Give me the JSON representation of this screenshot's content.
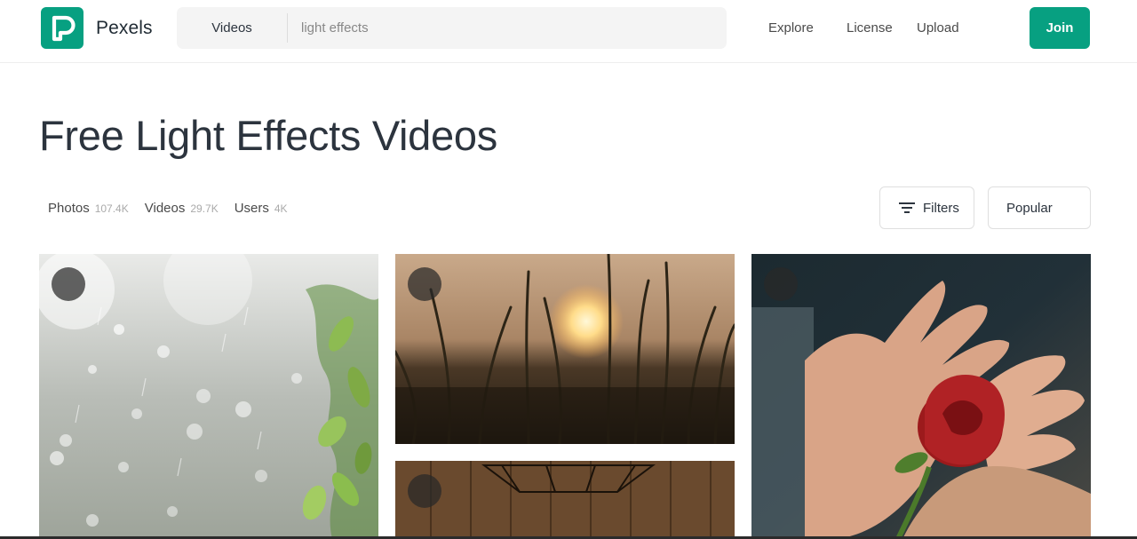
{
  "header": {
    "brand": "Pexels",
    "search": {
      "type_label": "Videos",
      "placeholder": "light effects"
    },
    "nav": [
      "Explore",
      "License",
      "Upload"
    ],
    "join_label": "Join",
    "accent": "#07a081"
  },
  "main": {
    "title": "Free Light Effects Videos",
    "tabs": [
      {
        "label": "Photos",
        "count": "107.4K"
      },
      {
        "label": "Videos",
        "count": "29.7K"
      },
      {
        "label": "Users",
        "count": "4K"
      }
    ],
    "filters_label": "Filters",
    "sort_label": "Popular"
  },
  "grid": {
    "items": [
      {
        "subject": "rain bokeh with green leaves"
      },
      {
        "subject": "grass at sunset"
      },
      {
        "subject": "wooden wall with hanging lamp"
      },
      {
        "subject": "hands holding red rose"
      }
    ]
  },
  "icons": {
    "logo": "pexels-logo-icon",
    "filters": "filter-lines-icon"
  }
}
